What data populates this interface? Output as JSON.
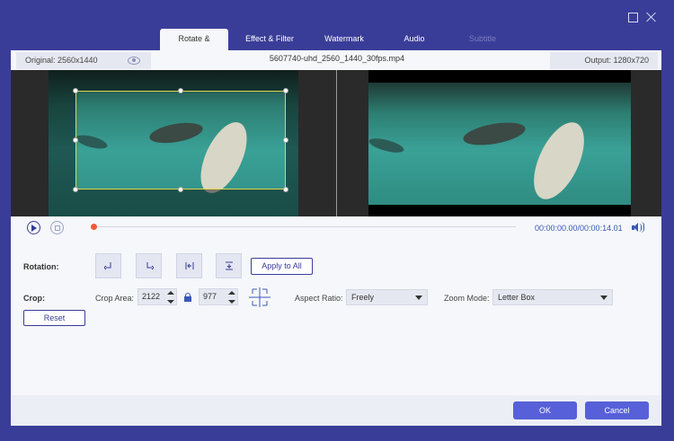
{
  "tabs": [
    {
      "label": "Rotate & Crop",
      "state": "active"
    },
    {
      "label": "Effect & Filter",
      "state": "normal"
    },
    {
      "label": "Watermark",
      "state": "normal"
    },
    {
      "label": "Audio",
      "state": "normal"
    },
    {
      "label": "Subtitle",
      "state": "disabled"
    }
  ],
  "info": {
    "original": "Original: 2560x1440",
    "filename": "5607740-uhd_2560_1440_30fps.mp4",
    "output": "Output: 1280x720"
  },
  "playback": {
    "time": "00:00:00.00/00:00:14.01",
    "progress": 0.0
  },
  "rotation": {
    "label": "Rotation:",
    "buttons": [
      "rotate-left-icon",
      "rotate-right-icon",
      "flip-horizontal-icon",
      "flip-vertical-icon"
    ],
    "apply_all": "Apply to All"
  },
  "crop": {
    "label": "Crop:",
    "area_label": "Crop Area:",
    "width": "2122",
    "height": "977",
    "aspect_label": "Aspect Ratio:",
    "aspect_value": "Freely",
    "zoom_label": "Zoom Mode:",
    "zoom_value": "Letter Box",
    "reset": "Reset"
  },
  "footer": {
    "ok": "OK",
    "cancel": "Cancel"
  },
  "colors": {
    "frame": "#3a3d98",
    "accent": "#5760d8",
    "crop_outline": "#e0d84a",
    "progress_knob": "#f05a3a"
  }
}
